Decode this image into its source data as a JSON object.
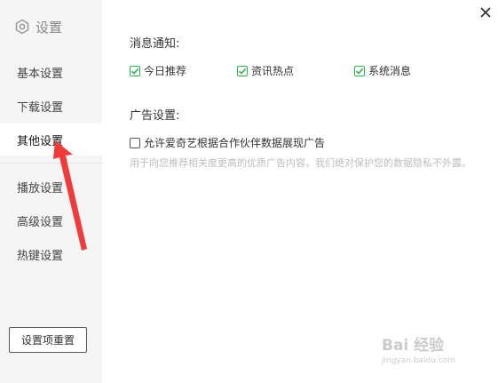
{
  "sidebar": {
    "title": "设置",
    "items": [
      {
        "label": "基本设置",
        "active": false
      },
      {
        "label": "下载设置",
        "active": false
      },
      {
        "label": "其他设置",
        "active": true
      },
      {
        "label": "播放设置",
        "active": false
      },
      {
        "label": "高级设置",
        "active": false
      },
      {
        "label": "热键设置",
        "active": false
      }
    ],
    "reset_label": "设置项重置"
  },
  "notifications": {
    "title": "消息通知:",
    "options": [
      {
        "label": "今日推荐",
        "checked": true
      },
      {
        "label": "资讯热点",
        "checked": true
      },
      {
        "label": "系统消息",
        "checked": true
      }
    ]
  },
  "ads": {
    "title": "广告设置:",
    "option": {
      "label": "允许爱奇艺根据合作伙伴数据展现广告",
      "checked": false
    },
    "hint": "用于向您推荐相关度更高的优质广告内容，我们绝对保护您的数据隐私不外露。"
  },
  "watermark": {
    "brand": "Bai 经验",
    "url": "jingyan.baidu.com"
  },
  "colors": {
    "check": "#2bb24c",
    "arrow": "#ef3b3b",
    "sidebar_bg": "#f5f5f5"
  },
  "icons": {
    "settings": "hexagon-settings-icon",
    "close": "close-icon",
    "check": "check-icon"
  }
}
